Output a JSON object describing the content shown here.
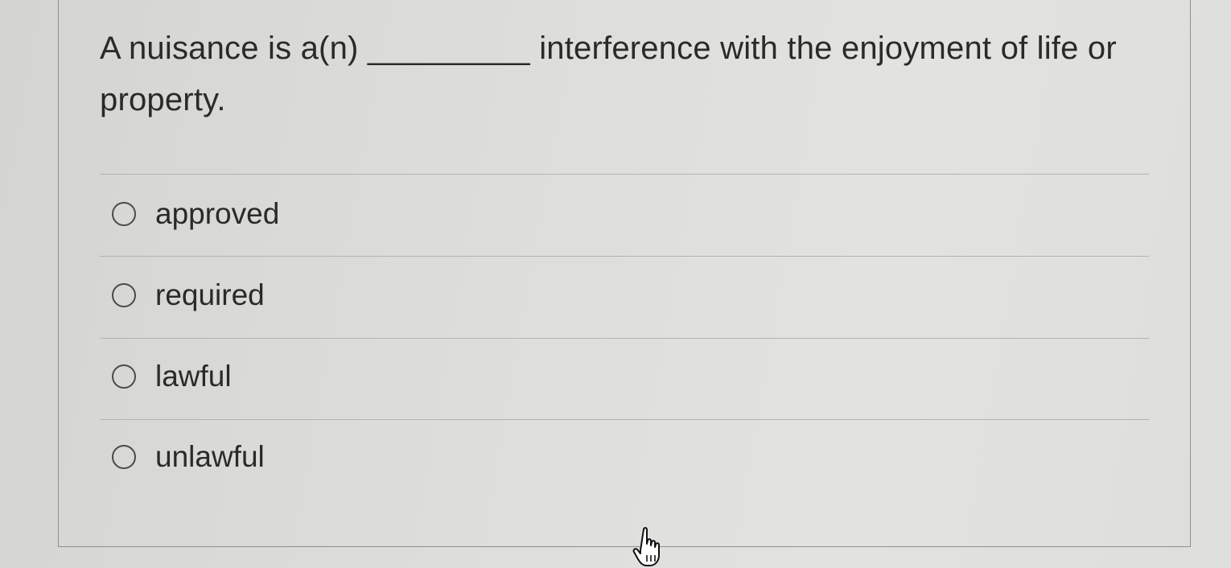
{
  "question": {
    "text": "A nuisance is a(n) _________ interference with the enjoyment of life or property."
  },
  "options": [
    {
      "label": "approved"
    },
    {
      "label": "required"
    },
    {
      "label": "lawful"
    },
    {
      "label": "unlawful"
    }
  ],
  "icons": {
    "radio": "radio-unchecked-icon",
    "cursor": "hand-pointer-icon"
  }
}
